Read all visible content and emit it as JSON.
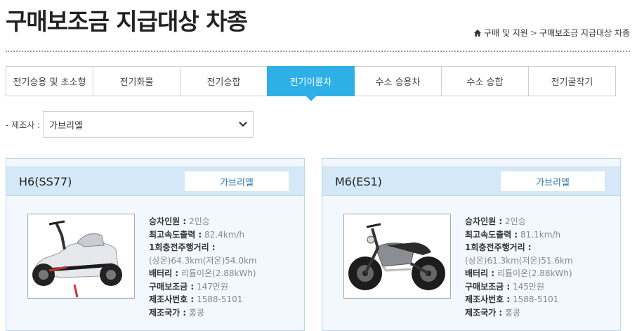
{
  "header": {
    "title": "구매보조금 지급대상 차종",
    "breadcrumb": [
      "구매 및 지원",
      "구매보조금 지급대상 차종"
    ]
  },
  "tabs": [
    {
      "label": "전기승용 및 초소형",
      "active": false
    },
    {
      "label": "전기화물",
      "active": false
    },
    {
      "label": "전기승합",
      "active": false
    },
    {
      "label": "전기이륜차",
      "active": true
    },
    {
      "label": "수소 승용차",
      "active": false
    },
    {
      "label": "수소 승합",
      "active": false
    },
    {
      "label": "전기굴착기",
      "active": false
    }
  ],
  "filter": {
    "label": "- 제조사 :",
    "value": "가브리엘"
  },
  "colors": {
    "accent": "#2eb0e6",
    "card_bg": "#f2f8fd",
    "card_head": "#d5e8f7"
  },
  "cards": [
    {
      "model": "H6(SS77)",
      "maker": "가브리엘",
      "image_icon": "scooter-photo",
      "specs": {
        "passengers_label": "승차인원 :",
        "passengers": "2인승",
        "speed_label": "최고속도출력 :",
        "speed": "82.4km/h",
        "range_label": "1회충전주행거리 :",
        "range": "(상온)64.3km(저온)54.0km",
        "battery_label": "배터리 :",
        "battery": "리튬이온(2.88kWh)",
        "subsidy_label": "구매보조금 :",
        "subsidy": "147만원",
        "phone_label": "제조사번호 :",
        "phone": "1588-5101",
        "country_label": "제조국가 :",
        "country": "홍콩"
      }
    },
    {
      "model": "M6(ES1)",
      "maker": "가브리엘",
      "image_icon": "motorcycle-photo",
      "specs": {
        "passengers_label": "승차인원 :",
        "passengers": "2인승",
        "speed_label": "최고속도출력 :",
        "speed": "81.1km/h",
        "range_label": "1회충전주행거리 :",
        "range": "(상온)61.3km(저온)51.6km",
        "battery_label": "배터리 :",
        "battery": "리튬이온(2.88kWh)",
        "subsidy_label": "구매보조금 :",
        "subsidy": "145만원",
        "phone_label": "제조사번호 :",
        "phone": "1588-5101",
        "country_label": "제조국가 :",
        "country": "홍콩"
      }
    }
  ]
}
